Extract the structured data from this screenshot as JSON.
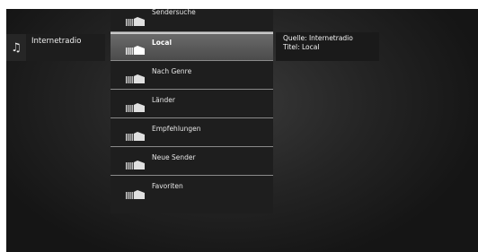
{
  "source": {
    "icon": "music-note-icon",
    "label": "Internetradio"
  },
  "menu": {
    "icon": "radio-signal-icon",
    "items": [
      {
        "label": "Sendersuche",
        "selected": false
      },
      {
        "label": "Local",
        "selected": true
      },
      {
        "label": "Nach Genre",
        "selected": false
      },
      {
        "label": "Länder",
        "selected": false
      },
      {
        "label": "Empfehlungen",
        "selected": false
      },
      {
        "label": "Neue Sender",
        "selected": false
      },
      {
        "label": "Favoriten",
        "selected": false
      }
    ]
  },
  "info": {
    "line1": "Quelle: Internetradio",
    "line2": "Titel: Local"
  }
}
